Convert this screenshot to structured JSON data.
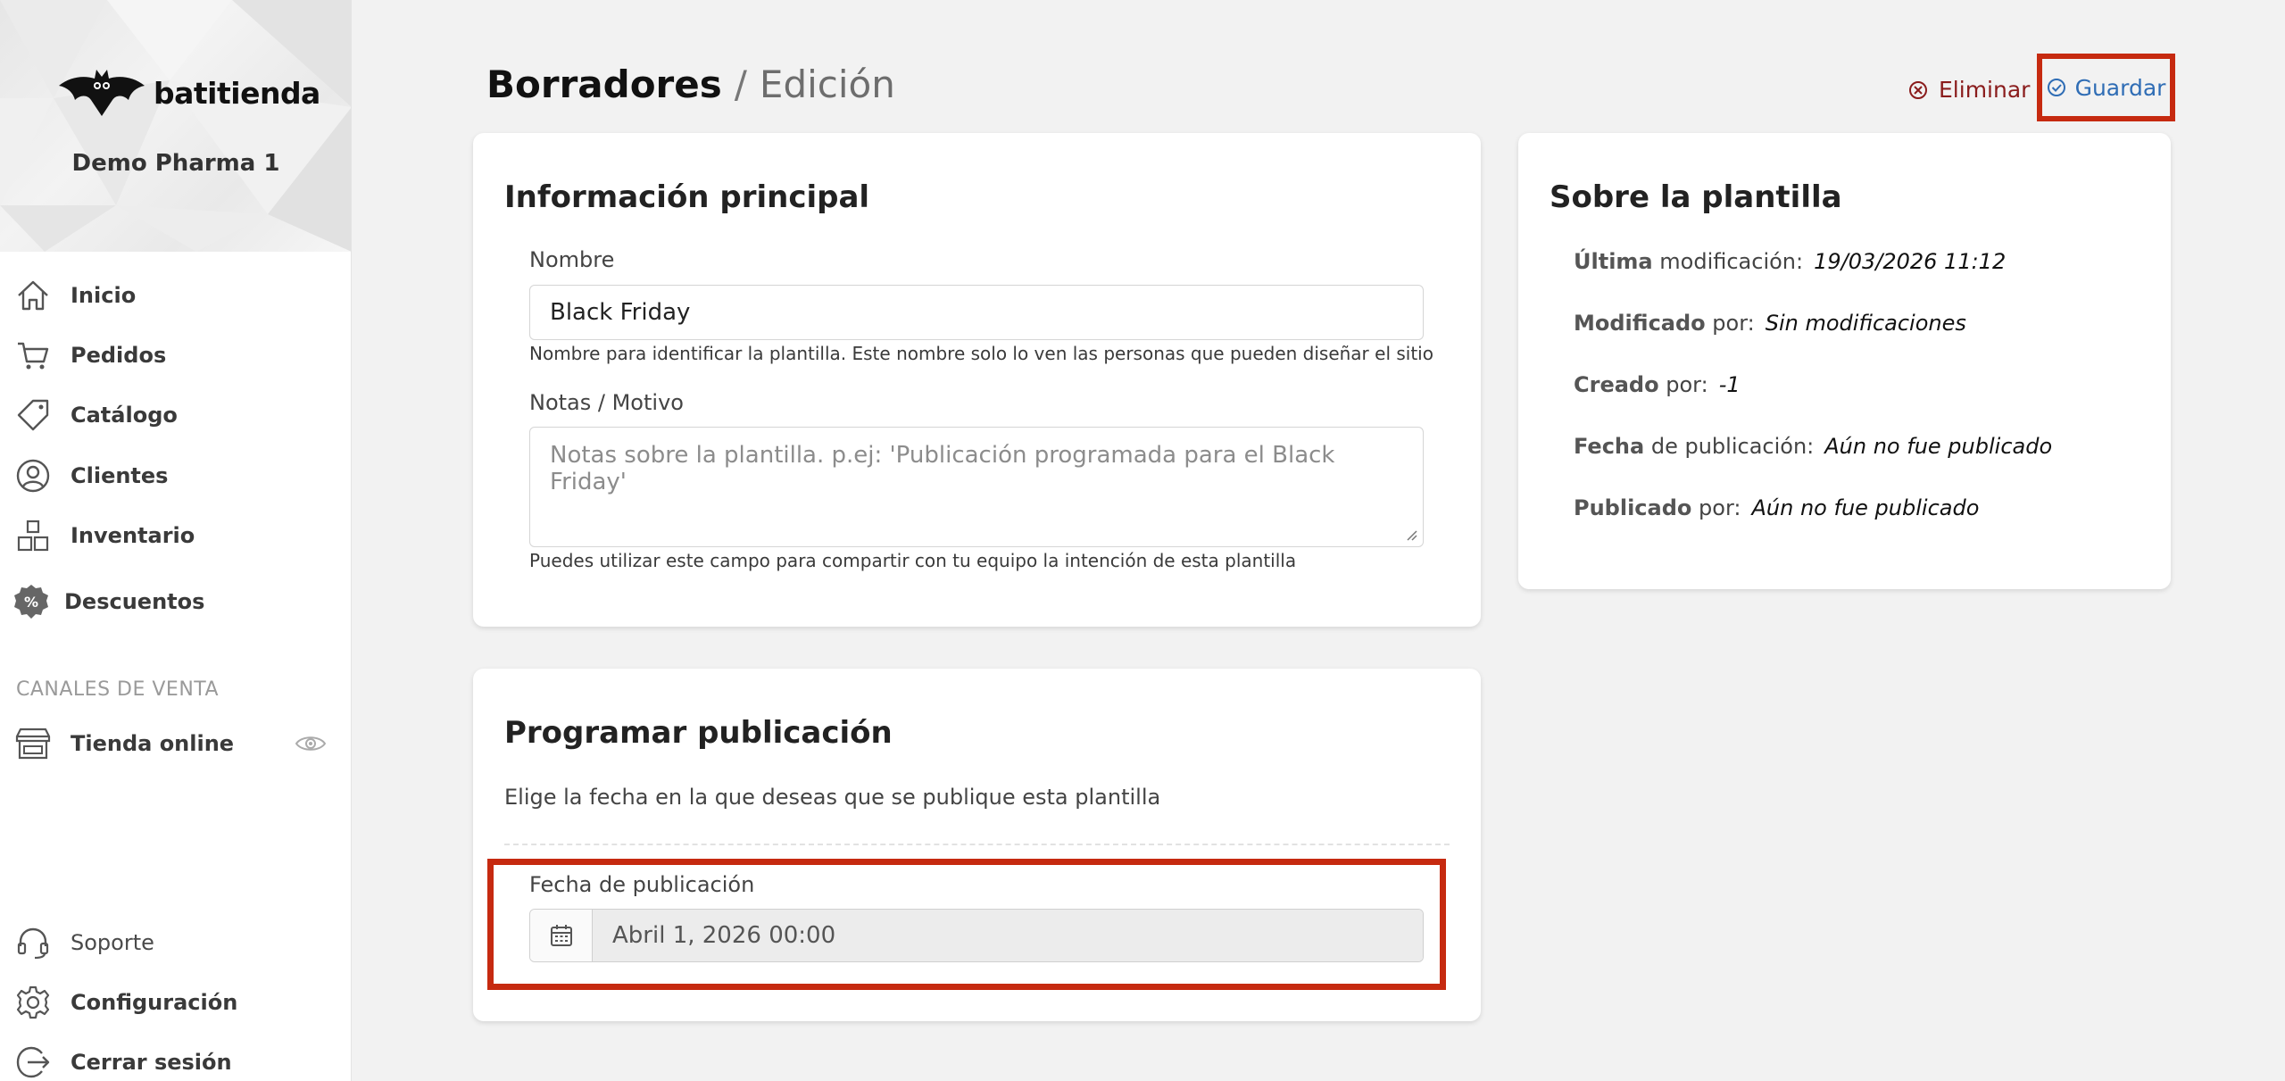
{
  "sidebar": {
    "brand": "batitienda",
    "store_name": "Demo Pharma 1",
    "nav": [
      {
        "label": "Inicio",
        "icon": "home-icon"
      },
      {
        "label": "Pedidos",
        "icon": "cart-icon"
      },
      {
        "label": "Catálogo",
        "icon": "tag-icon"
      },
      {
        "label": "Clientes",
        "icon": "user-circle-icon"
      },
      {
        "label": "Inventario",
        "icon": "boxes-icon"
      },
      {
        "label": "Descuentos",
        "icon": "discount-badge-icon"
      }
    ],
    "sales_section_title": "CANALES DE VENTA",
    "sales_channels": [
      {
        "label": "Tienda online",
        "icon": "store-icon"
      }
    ],
    "footer": [
      {
        "label": "Soporte",
        "icon": "headset-icon"
      },
      {
        "label": "Configuración",
        "icon": "gear-icon"
      },
      {
        "label": "Cerrar sesión",
        "icon": "logout-icon"
      }
    ]
  },
  "header": {
    "title": "Borradores",
    "separator": "/",
    "subtitle": "Edición",
    "delete_label": "Eliminar",
    "save_label": "Guardar"
  },
  "main_info": {
    "title": "Información principal",
    "name_label": "Nombre",
    "name_value": "Black Friday",
    "name_help": "Nombre para identificar la plantilla. Este nombre solo lo ven las personas que pueden diseñar el sitio",
    "notes_label": "Notas / Motivo",
    "notes_placeholder": "Notas sobre la plantilla. p.ej: 'Publicación programada para el Black Friday'",
    "notes_help": "Puedes utilizar este campo para compartir con tu equipo la intención de esta plantilla"
  },
  "about": {
    "title": "Sobre la plantilla",
    "rows": [
      {
        "key": "Última",
        "rest": "modificación:",
        "value": "19/03/2026 11:12"
      },
      {
        "key": "Modificado",
        "rest": "por:",
        "value": "Sin modificaciones"
      },
      {
        "key": "Creado",
        "rest": "por:",
        "value": "-1"
      },
      {
        "key": "Fecha",
        "rest": "de publicación:",
        "value": "Aún no fue publicado"
      },
      {
        "key": "Publicado",
        "rest": "por:",
        "value": "Aún no fue publicado"
      }
    ]
  },
  "schedule": {
    "title": "Programar publicación",
    "description": "Elige la fecha en la que deseas que se publique esta plantilla",
    "date_label": "Fecha de publicación",
    "date_value": "Abril 1, 2026 00:00"
  },
  "colors": {
    "accent_blue": "#2f6db5",
    "danger": "#8a1c1c",
    "highlight": "#c62a10"
  }
}
